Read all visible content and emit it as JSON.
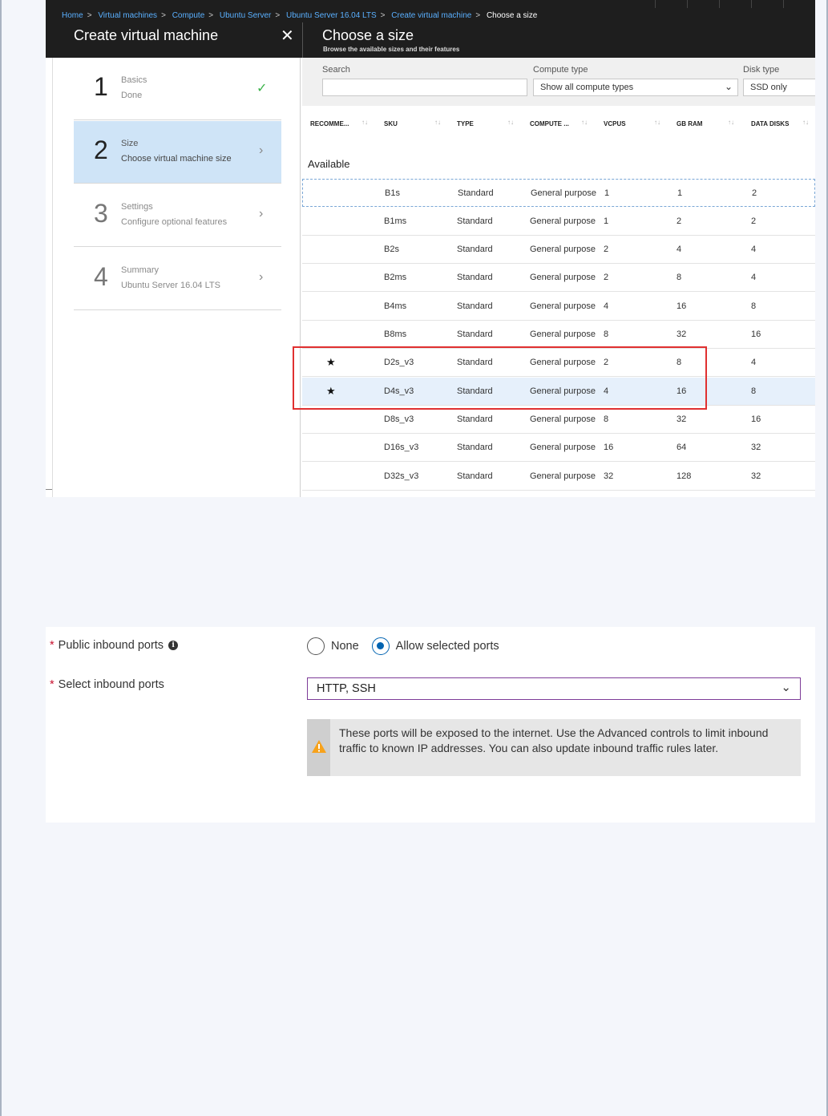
{
  "breadcrumb": {
    "items": [
      "Home",
      "Virtual machines",
      "Compute",
      "Ubuntu Server",
      "Ubuntu Server 16.04 LTS",
      "Create virtual machine"
    ],
    "separator": ">",
    "current": "Choose a size"
  },
  "left_blade": {
    "title": "Create virtual machine",
    "close_icon": "close-icon",
    "steps": [
      {
        "number": "1",
        "title": "Basics",
        "subtitle": "Done",
        "status": "done"
      },
      {
        "number": "2",
        "title": "Size",
        "subtitle": "Choose virtual machine size",
        "status": "active"
      },
      {
        "number": "3",
        "title": "Settings",
        "subtitle": "Configure optional features",
        "status": "pending"
      },
      {
        "number": "4",
        "title": "Summary",
        "subtitle": "Ubuntu Server 16.04 LTS",
        "status": "pending"
      }
    ]
  },
  "right_blade": {
    "title": "Choose a size",
    "subtitle": "Browse the available sizes and their features",
    "filters": {
      "search_label": "Search",
      "search_value": "",
      "compute_type_label": "Compute type",
      "compute_type_value": "Show all compute types",
      "disk_type_label": "Disk type",
      "disk_type_value": "SSD only"
    },
    "columns": [
      "RECOMME...",
      "SKU",
      "TYPE",
      "COMPUTE ...",
      "VCPUS",
      "GB RAM",
      "DATA DISKS"
    ],
    "group_label": "Available",
    "rows": [
      {
        "recommended": "",
        "sku": "B1s",
        "type": "Standard",
        "compute": "General purpose",
        "vcpus": "1",
        "ram": "1",
        "disks": "2"
      },
      {
        "recommended": "",
        "sku": "B1ms",
        "type": "Standard",
        "compute": "General purpose",
        "vcpus": "1",
        "ram": "2",
        "disks": "2"
      },
      {
        "recommended": "",
        "sku": "B2s",
        "type": "Standard",
        "compute": "General purpose",
        "vcpus": "2",
        "ram": "4",
        "disks": "4"
      },
      {
        "recommended": "",
        "sku": "B2ms",
        "type": "Standard",
        "compute": "General purpose",
        "vcpus": "2",
        "ram": "8",
        "disks": "4"
      },
      {
        "recommended": "",
        "sku": "B4ms",
        "type": "Standard",
        "compute": "General purpose",
        "vcpus": "4",
        "ram": "16",
        "disks": "8"
      },
      {
        "recommended": "",
        "sku": "B8ms",
        "type": "Standard",
        "compute": "General purpose",
        "vcpus": "8",
        "ram": "32",
        "disks": "16"
      },
      {
        "recommended": "★",
        "sku": "D2s_v3",
        "type": "Standard",
        "compute": "General purpose",
        "vcpus": "2",
        "ram": "8",
        "disks": "4"
      },
      {
        "recommended": "★",
        "sku": "D4s_v3",
        "type": "Standard",
        "compute": "General purpose",
        "vcpus": "4",
        "ram": "16",
        "disks": "8"
      },
      {
        "recommended": "",
        "sku": "D8s_v3",
        "type": "Standard",
        "compute": "General purpose",
        "vcpus": "8",
        "ram": "32",
        "disks": "16"
      },
      {
        "recommended": "",
        "sku": "D16s_v3",
        "type": "Standard",
        "compute": "General purpose",
        "vcpus": "16",
        "ram": "64",
        "disks": "32"
      },
      {
        "recommended": "",
        "sku": "D32s_v3",
        "type": "Standard",
        "compute": "General purpose",
        "vcpus": "32",
        "ram": "128",
        "disks": "32"
      }
    ],
    "selected_sku": "D4s_v3",
    "highlighted_skus": [
      "D2s_v3",
      "D4s_v3"
    ]
  },
  "inbound": {
    "public_ports_label": "Public inbound ports",
    "required_marker": "*",
    "options": [
      "None",
      "Allow selected ports"
    ],
    "selected_option": "Allow selected ports",
    "select_ports_label": "Select inbound ports",
    "select_ports_value": "HTTP, SSH",
    "warning_text": "These ports will be exposed to the internet. Use the Advanced controls to limit inbound traffic to known IP addresses. You can also update inbound traffic rules later."
  },
  "colors": {
    "topbar": "#1e1e1e",
    "link": "#5ab0ff",
    "active_step": "#cfe4f7",
    "check": "#3bb34a",
    "highlight_box": "#e03030",
    "radio_selected": "#0063b1",
    "select_border": "#7d3c98",
    "warning_icon": "#f7a21b",
    "required": "#c8102e"
  }
}
